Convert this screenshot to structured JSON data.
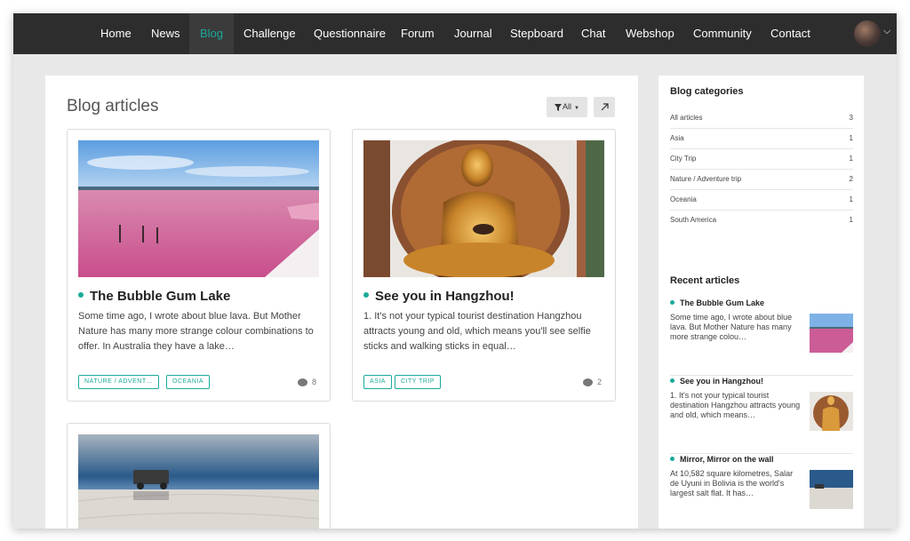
{
  "nav": {
    "items": [
      "Home",
      "News",
      "Blog",
      "Challenge",
      "Questionnaire",
      "Forum",
      "Journal",
      "Stepboard",
      "Chat",
      "Webshop",
      "Community",
      "Contact"
    ],
    "active": "Blog"
  },
  "main": {
    "title": "Blog articles",
    "filter_label": "All",
    "cards": [
      {
        "title": "The Bubble Gum Lake",
        "excerpt": "Some time ago, I wrote about blue lava. But Mother Nature has many more strange colour combinations to offer. In Australia they have a lake…",
        "tags": [
          "NATURE / ADVENT…",
          "OCEANIA"
        ],
        "comments": "8"
      },
      {
        "title": "See you in Hangzhou!",
        "excerpt": "1. It's not your typical tourist destination Hangzhou attracts young and old, which means you'll see selfie sticks and walking sticks in equal…",
        "tags": [
          "ASIA",
          "CITY TRIP"
        ],
        "comments": "2"
      }
    ]
  },
  "sidebar": {
    "categories_title": "Blog categories",
    "categories": [
      {
        "label": "All articles",
        "count": "3"
      },
      {
        "label": "Asia",
        "count": "1"
      },
      {
        "label": "City Trip",
        "count": "1"
      },
      {
        "label": "Nature / Adventure trip",
        "count": "2"
      },
      {
        "label": "Oceania",
        "count": "1"
      },
      {
        "label": "South America",
        "count": "1"
      }
    ],
    "recent_title": "Recent articles",
    "recent": [
      {
        "title": "The Bubble Gum Lake",
        "excerpt": "Some time ago, I wrote about blue lava. But Mother Nature has many more strange colou…"
      },
      {
        "title": "See you in Hangzhou!",
        "excerpt": "1. It's not your typical tourist destination Hangzhou attracts young and old, which means…"
      },
      {
        "title": "Mirror, Mirror on the wall",
        "excerpt": "At 10,582 square kilometres, Salar de Uyuni in Bolivia is the world's largest salt flat. It has…"
      }
    ]
  },
  "colors": {
    "accent": "#1aaa9a",
    "nav_bg": "#2d2d2d",
    "page_bg": "#e8e8e8"
  }
}
